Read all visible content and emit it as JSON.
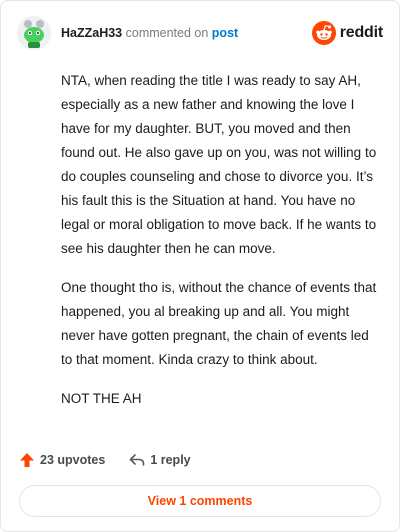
{
  "header": {
    "username": "HaZZaH33",
    "commented_text": "commented on",
    "post_link": "post",
    "brand": "reddit",
    "icons": {
      "avatar": "snoo-avatar",
      "brand_logo": "reddit-logo-icon"
    }
  },
  "comment": {
    "paragraphs": [
      "NTA, when reading the title I was ready to say AH, especially as a new father and knowing the love I have for my daughter. BUT, you moved and then found out. He also gave up on you, was not willing to do couples counseling and chose to divorce you. It’s his fault this is the Situation at hand. You have no legal or moral obligation to move back. If he wants to see his daughter then he can move.",
      "One thought tho is, without the chance of events that happened, you al breaking up and all. You might never have gotten pregnant, the chain of events led to that moment. Kinda crazy to think about.",
      "NOT THE AH"
    ]
  },
  "actions": {
    "upvotes": "23 upvotes",
    "replies": "1 reply",
    "view_comments": "View 1 comments"
  },
  "colors": {
    "accent": "#ff4500",
    "link": "#0079d3",
    "avatar_green": "#46d160"
  }
}
